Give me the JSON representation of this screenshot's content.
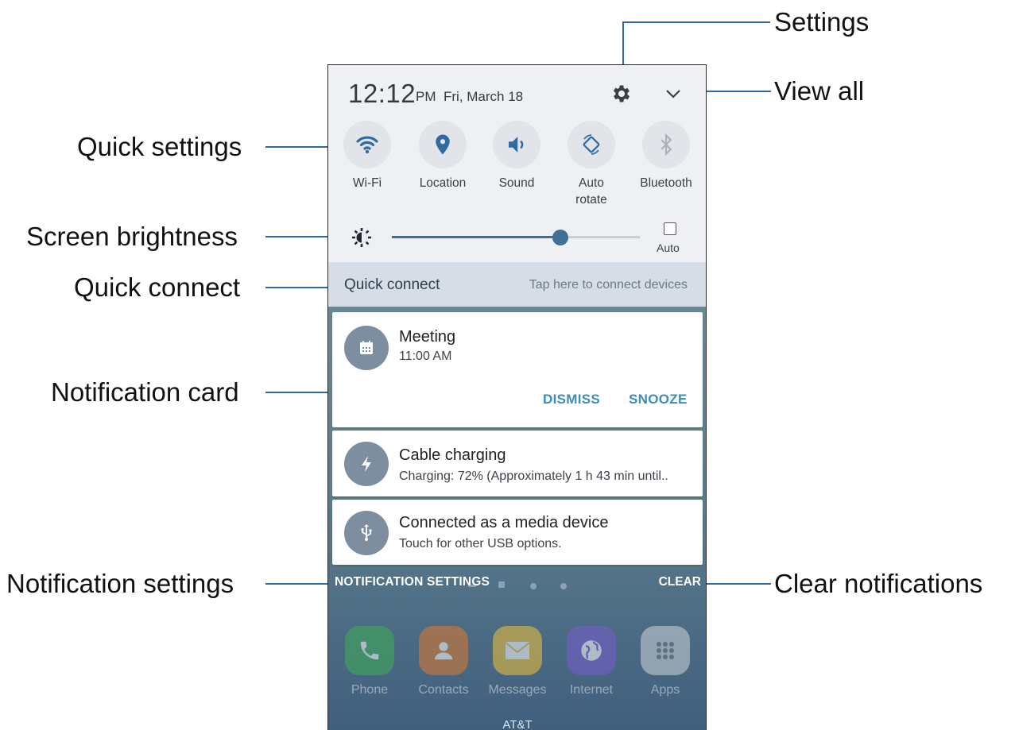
{
  "callouts": {
    "settings": "Settings",
    "view_all": "View all",
    "quick_settings": "Quick settings",
    "screen_brightness": "Screen brightness",
    "quick_connect": "Quick connect",
    "notification_card": "Notification card",
    "notification_settings": "Notification settings",
    "clear_notifications": "Clear notifications"
  },
  "status": {
    "time": "12:12",
    "ampm": "PM",
    "date": "Fri, March 18"
  },
  "header_icons": {
    "settings_icon": "gear-icon",
    "expand_icon": "chevron-down-icon"
  },
  "quick_settings": [
    {
      "label": "Wi-Fi",
      "icon": "wifi-icon"
    },
    {
      "label": "Location",
      "icon": "location-pin-icon"
    },
    {
      "label": "Sound",
      "icon": "speaker-icon"
    },
    {
      "label": "Auto\nrotate",
      "icon": "auto-rotate-icon"
    },
    {
      "label": "Bluetooth",
      "icon": "bluetooth-icon"
    }
  ],
  "brightness": {
    "level": 0.68,
    "auto_label": "Auto",
    "auto_checked": false
  },
  "quick_connect": {
    "title": "Quick connect",
    "hint": "Tap here to connect devices"
  },
  "notifications": [
    {
      "title": "Meeting",
      "subtitle": "11:00 AM",
      "icon": "calendar-icon",
      "actions": [
        "DISMISS",
        "SNOOZE"
      ]
    },
    {
      "title": "Cable charging",
      "subtitle": "Charging: 72% (Approximately 1 h 43 min until..",
      "icon": "bolt-icon"
    },
    {
      "title": "Connected as a media device",
      "subtitle": "Touch for other USB options.",
      "icon": "usb-icon"
    }
  ],
  "footer": {
    "notification_settings": "NOTIFICATION SETTINGS",
    "clear": "CLEAR"
  },
  "dock": {
    "apps": [
      {
        "label": "Phone",
        "icon": "phone-icon",
        "color": "#3fae58"
      },
      {
        "label": "Contacts",
        "icon": "contact-icon",
        "color": "#e07a2e"
      },
      {
        "label": "Messages",
        "icon": "envelope-icon",
        "color": "#f2c23a"
      },
      {
        "label": "Internet",
        "icon": "globe-icon",
        "color": "#7a5bd0"
      },
      {
        "label": "Apps",
        "icon": "apps-grid-icon",
        "color": "#cfd3d8"
      }
    ],
    "carrier": "AT&T"
  },
  "colors": {
    "accent": "#3a8db8",
    "callout_line": "#2f6aa0",
    "panel": "#eef0f3",
    "quick_connect_bg": "#d6dde4"
  }
}
